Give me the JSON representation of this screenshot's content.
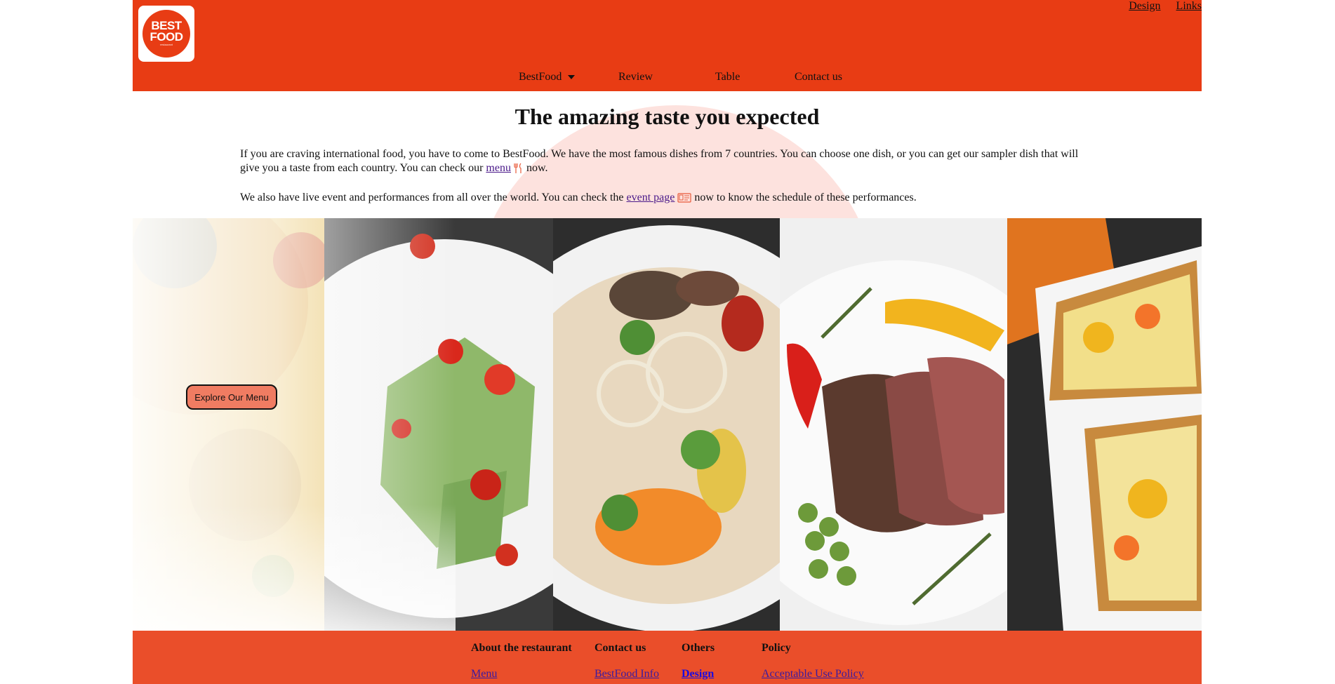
{
  "brand": {
    "logo_line1": "BEST",
    "logo_line2": "FOOD",
    "logo_tagline": "restaurant",
    "primary_color": "#e83c14",
    "footer_color": "#ea4e2a"
  },
  "top_links": [
    "Design",
    "Links"
  ],
  "nav": {
    "items": [
      "BestFood",
      "Review",
      "Table",
      "Contact us"
    ]
  },
  "intro": {
    "headline": "The amazing taste you expected",
    "p1_text": "If you are craving international food, you have to come to BestFood. We have the most famous dishes from 7 countries. You can choose one dish, or you can get our sampler dish that will give you a taste from each country. You can check our ",
    "p1_link": "menu",
    "p1_tail": " now.",
    "p2_text": "We also have live event and performances from all over the world. You can check the ",
    "p2_link": "event page",
    "p2_tail": " now to know the schedule of these performances."
  },
  "hero": {
    "cta_label": "Explore Our Menu"
  },
  "footer": {
    "columns": [
      {
        "title": "About the restaurant",
        "links": [
          "Menu"
        ]
      },
      {
        "title": "Contact us",
        "links": [
          "BestFood Info"
        ]
      },
      {
        "title": "Others",
        "links": [
          "Design"
        ]
      },
      {
        "title": "Policy",
        "links": [
          "Acceptable Use Policy"
        ]
      }
    ]
  }
}
